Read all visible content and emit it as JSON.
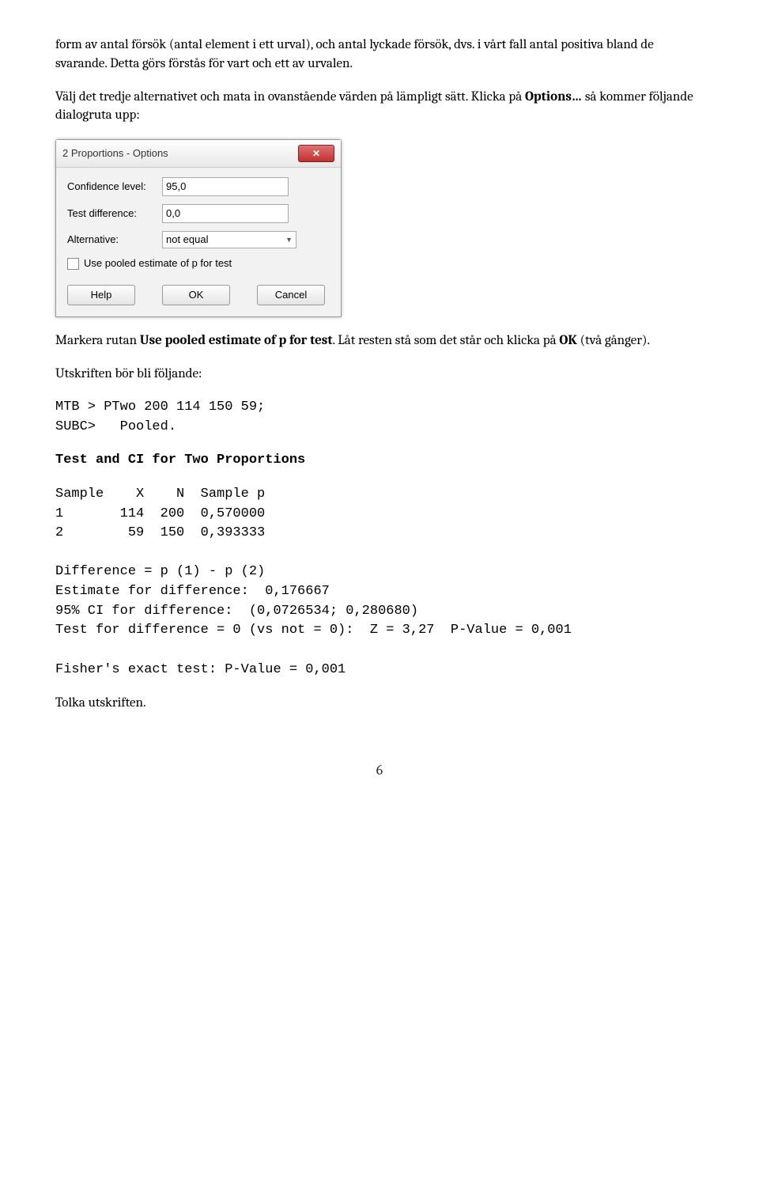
{
  "para1": "form av antal försök (antal element i ett urval), och antal lyckade försök, dvs. i vårt fall antal positiva bland de svarande. Detta görs förstås för vart och ett av urvalen.",
  "para2_a": "Välj det tredje alternativet och mata in ovanstående värden på lämpligt sätt. Klicka på ",
  "para2_b": "Options…",
  "para2_c": " så kommer följande dialogruta upp:",
  "dialog": {
    "title": "2 Proportions - Options",
    "close": "✕",
    "confidence_label": "Confidence level:",
    "confidence_value": "95,0",
    "testdiff_label": "Test difference:",
    "testdiff_value": "0,0",
    "alt_label": "Alternative:",
    "alt_value": "not equal",
    "checkbox_label": "Use pooled estimate of p for test",
    "help": "Help",
    "ok": "OK",
    "cancel": "Cancel"
  },
  "para3_a": "Markera rutan ",
  "para3_b": "Use pooled estimate of p for test",
  "para3_c": ". Låt resten stå som det står och klicka på ",
  "para3_d": "OK",
  "para3_e": " (två gånger).",
  "para4": "Utskriften bör bli följande:",
  "code1": "MTB > PTwo 200 114 150 59;\nSUBC>   Pooled.",
  "code_heading": "Test and CI for Two Proportions",
  "code2": "Sample    X    N  Sample p\n1       114  200  0,570000\n2        59  150  0,393333\n\nDifference = p (1) - p (2)\nEstimate for difference:  0,176667\n95% CI for difference:  (0,0726534; 0,280680)\nTest for difference = 0 (vs not = 0):  Z = 3,27  P-Value = 0,001\n\nFisher's exact test: P-Value = 0,001",
  "para5": "Tolka utskriften.",
  "page": "6"
}
